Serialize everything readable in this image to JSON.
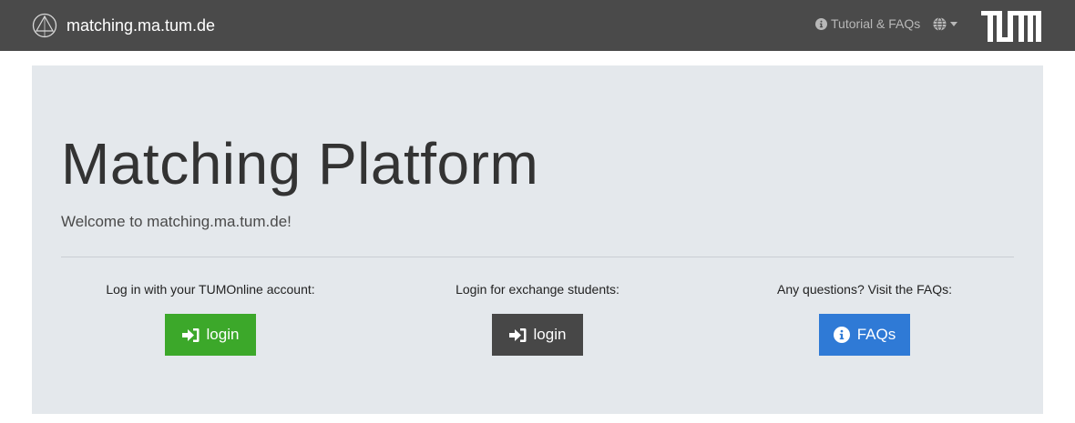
{
  "navbar": {
    "brand": "matching.ma.tum.de",
    "tutorial_link": "Tutorial & FAQs",
    "logo_text": "TUM",
    "background": "#4a4a4a"
  },
  "jumbotron": {
    "title": "Matching Platform",
    "lead": "Welcome to matching.ma.tum.de!",
    "background": "#e4e8ec"
  },
  "columns": [
    {
      "label": "Log in with your TUMOnline account:",
      "button_label": "login",
      "button_icon": "sign-in-icon",
      "button_color": "#3ca82a"
    },
    {
      "label": "Login for exchange students:",
      "button_label": "login",
      "button_icon": "sign-in-icon",
      "button_color": "#474747"
    },
    {
      "label": "Any questions? Visit the FAQs:",
      "button_label": "FAQs",
      "button_icon": "info-circle-icon",
      "button_color": "#2f7ad6"
    }
  ]
}
